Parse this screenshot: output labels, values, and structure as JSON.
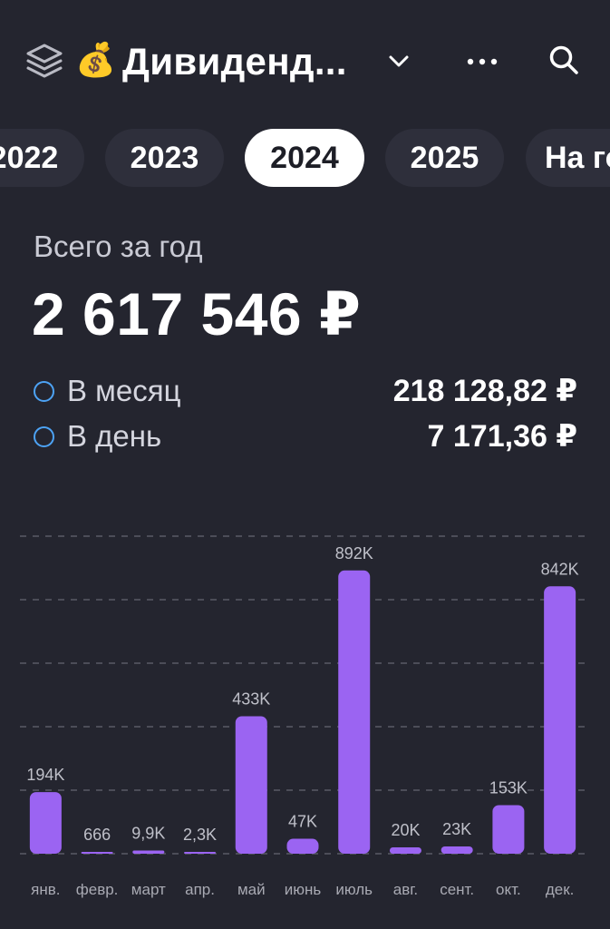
{
  "header": {
    "title": "Дивиденд...",
    "money_emoji": "💰",
    "icons": [
      "layers-icon",
      "money-bag-icon",
      "chevron-down-icon",
      "more-icon",
      "search-icon"
    ]
  },
  "tabs": [
    {
      "label": "2022",
      "active": false
    },
    {
      "label": "2023",
      "active": false
    },
    {
      "label": "2024",
      "active": true
    },
    {
      "label": "2025",
      "active": false
    },
    {
      "label": "На го",
      "active": false
    }
  ],
  "summary": {
    "label": "Всего за год",
    "total": "2 617 546 ₽",
    "stats": [
      {
        "label": "В месяц",
        "value": "218 128,82 ₽"
      },
      {
        "label": "В день",
        "value": "7 171,36 ₽"
      }
    ]
  },
  "colors": {
    "background": "#24252f",
    "bar": "#9b64f2",
    "tab_bg": "#2e2f3b",
    "tab_active_bg": "#ffffff",
    "stat_circle": "#4da3f5",
    "grid": "#5a5b66",
    "bar_label": "#bfc0c9",
    "axis_label": "#a9aab3"
  },
  "chart_data": {
    "type": "bar",
    "categories": [
      "янв.",
      "февр.",
      "март",
      "апр.",
      "май",
      "июнь",
      "июль",
      "авг.",
      "сент.",
      "окт.",
      "дек."
    ],
    "values": [
      194000,
      666,
      9900,
      2300,
      433000,
      47000,
      892000,
      20000,
      23000,
      153000,
      842000
    ],
    "data_labels": [
      "194K",
      "666",
      "9,9K",
      "2,3K",
      "433K",
      "47K",
      "892K",
      "20K",
      "23K",
      "153K",
      "842K"
    ],
    "ylim": [
      0,
      1000000
    ],
    "grid": true
  }
}
